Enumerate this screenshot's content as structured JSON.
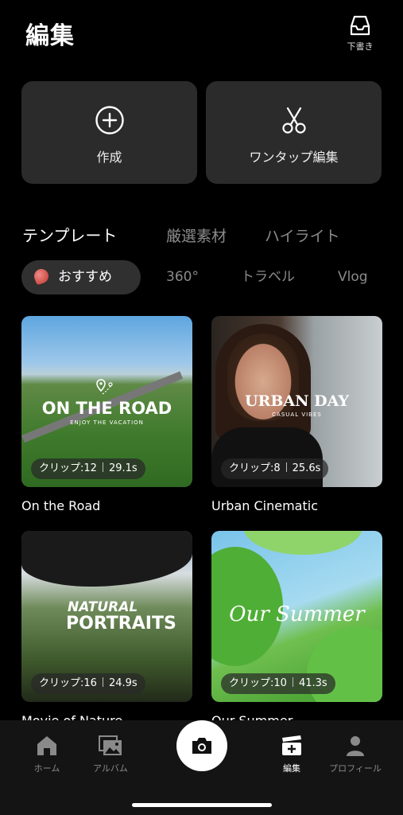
{
  "header": {
    "title": "編集",
    "drafts_label": "下書き",
    "drafts_icon": "inbox-tray-icon"
  },
  "actions": [
    {
      "label": "作成",
      "icon": "plus-circle-icon"
    },
    {
      "label": "ワンタップ編集",
      "icon": "scissors-icon"
    }
  ],
  "tabs": [
    {
      "label": "テンプレート",
      "active": true
    },
    {
      "label": "厳選素材",
      "active": false
    },
    {
      "label": "ハイライト",
      "active": false
    }
  ],
  "chips": [
    {
      "label": "おすすめ",
      "active": true,
      "icon": "petal-icon"
    },
    {
      "label": "360°",
      "active": false
    },
    {
      "label": "トラベル",
      "active": false
    },
    {
      "label": "Vlog",
      "active": false
    }
  ],
  "templates": [
    {
      "title": "On the Road",
      "clips": "クリップ:12",
      "duration": "29.1s",
      "overlay": "ON THE ROAD",
      "overlay_sub": "ENJOY THE VACATION"
    },
    {
      "title": "Urban Cinematic",
      "clips": "クリップ:8",
      "duration": "25.6s",
      "overlay": "URBAN DAY",
      "overlay_sub": "CASUAL VIBES"
    },
    {
      "title": "Movie of Nature",
      "clips": "クリップ:16",
      "duration": "24.9s",
      "overlay": "NATURAL",
      "overlay_2": "PORTRAITS"
    },
    {
      "title": "Our Summer",
      "clips": "クリップ:10",
      "duration": "41.3s",
      "overlay": "Our Summer"
    }
  ],
  "bottom_nav": [
    {
      "label": "ホーム",
      "icon": "home-icon",
      "active": false
    },
    {
      "label": "アルバム",
      "icon": "album-icon",
      "active": false
    },
    {
      "label": "",
      "icon": "camera-icon",
      "active": false
    },
    {
      "label": "編集",
      "icon": "edit-clapper-icon",
      "active": true
    },
    {
      "label": "プロフィール",
      "icon": "person-icon",
      "active": false
    }
  ]
}
